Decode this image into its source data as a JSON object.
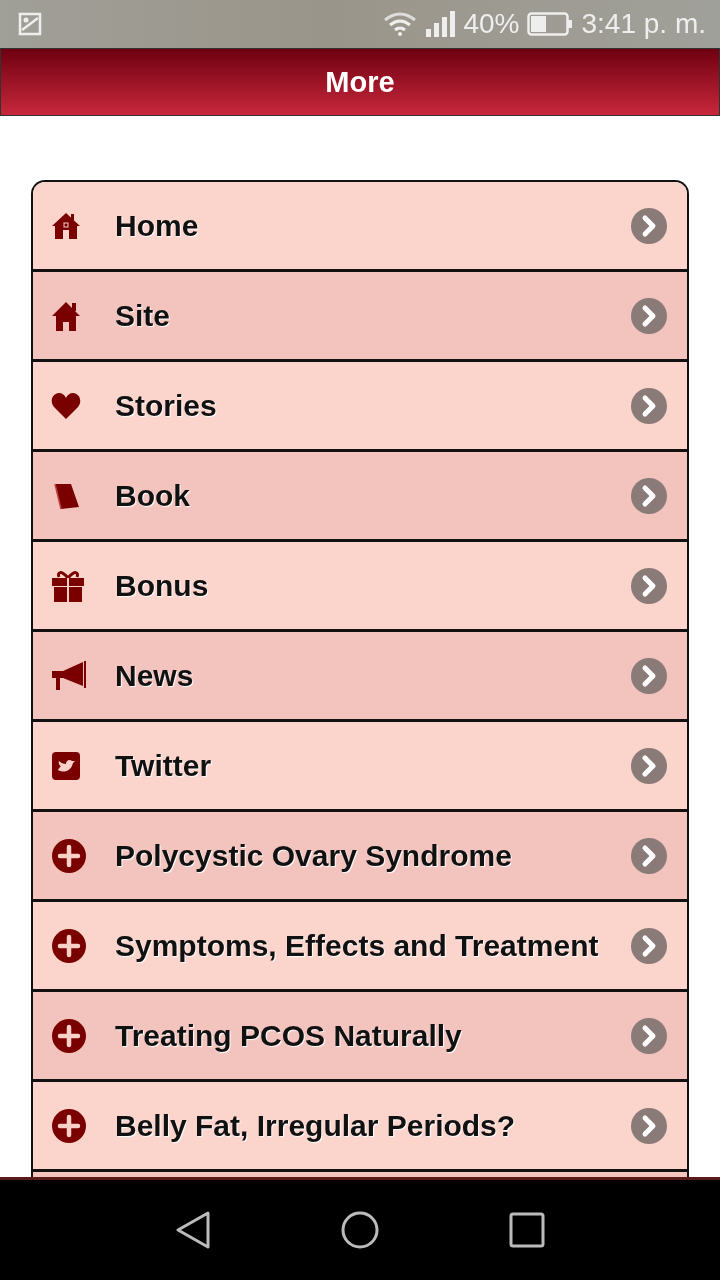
{
  "status_bar": {
    "battery": "40%",
    "time": "3:41 p. m."
  },
  "header": {
    "title": "More"
  },
  "menu": [
    {
      "label": "Home",
      "kind": "home"
    },
    {
      "label": "Site",
      "kind": "house"
    },
    {
      "label": "Stories",
      "kind": "heart"
    },
    {
      "label": "Book",
      "kind": "book"
    },
    {
      "label": "Bonus",
      "kind": "gift"
    },
    {
      "label": "News",
      "kind": "megaphone"
    },
    {
      "label": "Twitter",
      "kind": "twitter"
    },
    {
      "label": "Polycystic Ovary Syndrome",
      "kind": "plus"
    },
    {
      "label": "Symptoms, Effects and Treatment",
      "kind": "plus"
    },
    {
      "label": "Treating PCOS Naturally",
      "kind": "plus"
    },
    {
      "label": "Belly Fat, Irregular Periods?",
      "kind": "plus"
    }
  ]
}
